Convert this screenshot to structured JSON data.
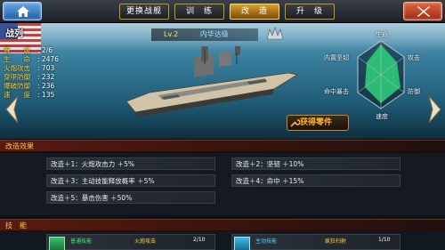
{
  "topbar": {
    "tabs": [
      "更换战舰",
      "训　练",
      "改　造",
      "升　级"
    ],
    "active_tab": "改　造"
  },
  "ship": {
    "type_label": "战列",
    "level": "Lv.2",
    "name": "内华达级",
    "stats": [
      {
        "label": "等　　级",
        "value": "2/6"
      },
      {
        "label": "生　　命",
        "value": "2476"
      },
      {
        "label": "火炮攻击",
        "value": "703"
      },
      {
        "label": "穿甲防御",
        "value": "232"
      },
      {
        "label": "爆破防御",
        "value": "236"
      },
      {
        "label": "速　　度",
        "value": "135"
      }
    ],
    "get_parts_label": "获得零件"
  },
  "radar": {
    "labels": {
      "life": "生命",
      "attack": "攻击",
      "defense": "防御",
      "speed": "速度",
      "hit_crit": "命中暴击",
      "inner_armor": "内置坚韧"
    }
  },
  "mods": {
    "title": "改造效果",
    "items": [
      "改造＋1：火炮攻击力 ＋5%",
      "改造＋2：坚韧 ＋10%",
      "改造＋3：主动技能释放概率 ＋5%",
      "改造＋4：命中 ＋15%",
      "改造＋5：暴击伤害 ＋50%"
    ]
  },
  "skills": {
    "title": "技　能",
    "cards": [
      {
        "type": "普通技能",
        "name": "火炮攻击",
        "level": "2/10"
      },
      {
        "type": "主动技能",
        "name": "疯狂扫射",
        "level": "1/10"
      }
    ]
  },
  "colors": {
    "accent_gold": "#ffd23c",
    "tab_active": "#d7a22a",
    "radar_fill": "#2fd07a"
  }
}
